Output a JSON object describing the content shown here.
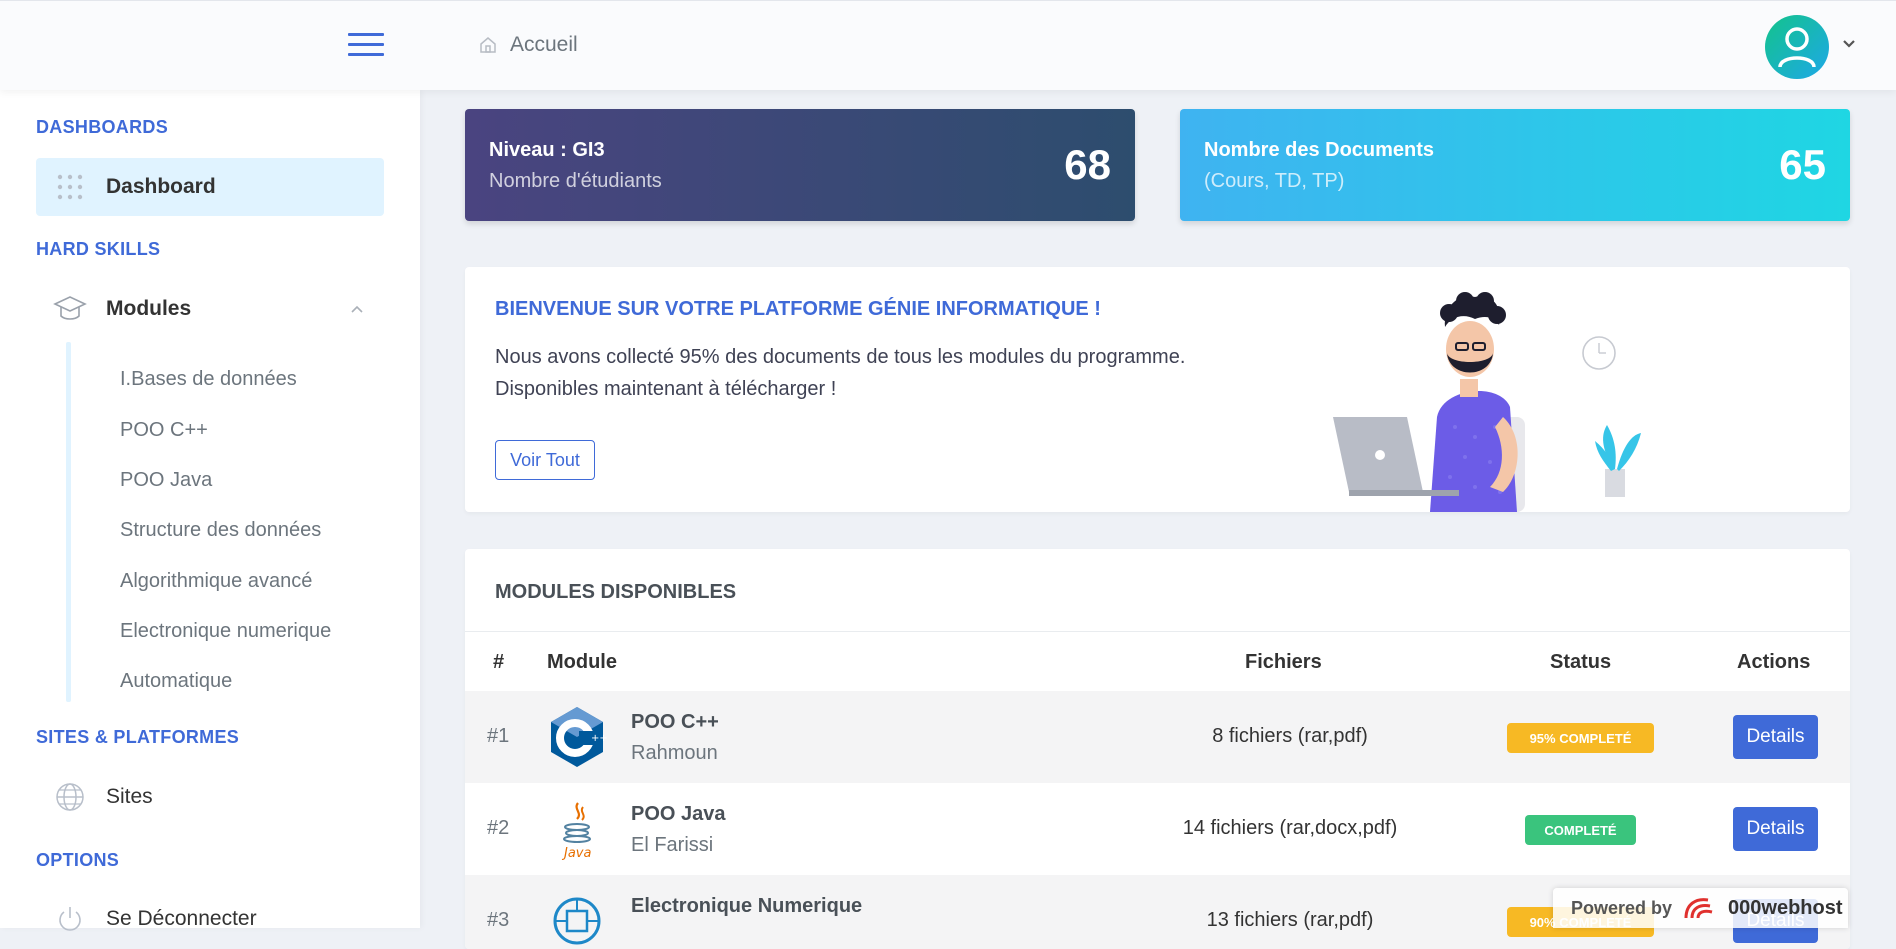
{
  "header": {
    "breadcrumb": "Accueil"
  },
  "sidebar": {
    "sections": {
      "dashboards": "DASHBOARDS",
      "hard_skills": "HARD SKILLS",
      "sites": "SITES & PLATFORMES",
      "options": "OPTIONS"
    },
    "dashboard": "Dashboard",
    "modules": "Modules",
    "submodules": [
      "I.Bases de données",
      "POO C++",
      "POO Java",
      "Structure des données",
      "Algorithmique avancé",
      "Electronique numerique",
      "Automatique"
    ],
    "sites": "Sites",
    "logout": "Se Déconnecter"
  },
  "cards": [
    {
      "title": "Niveau : GI3",
      "subtitle": "Nombre d'étudiants",
      "value": "68"
    },
    {
      "title": "Nombre des Documents",
      "subtitle": "(Cours, TD, TP)",
      "value": "65"
    }
  ],
  "welcome": {
    "title": "BIENVENUE SUR VOTRE PLATFORME GÉNIE INFORMATIQUE !",
    "line1": "Nous avons collecté 95% des documents de tous les modules du programme.",
    "line2": "Disponibles maintenant à télécharger !",
    "button": "Voir Tout"
  },
  "modules": {
    "title": "MODULES DISPONIBLES",
    "headers": [
      "#",
      "Module",
      "Fichiers",
      "Status",
      "Actions"
    ],
    "rows": [
      {
        "num": "#1",
        "name": "POO C++",
        "prof": "Rahmoun",
        "files": "8 fichiers (rar,pdf)",
        "status": "95% COMPLETÉ",
        "action": "Details"
      },
      {
        "num": "#2",
        "name": "POO Java",
        "prof": "El Farissi",
        "files": "14 fichiers (rar,docx,pdf)",
        "status": "COMPLETÉ",
        "action": "Details"
      },
      {
        "num": "#3",
        "name": "Electronique Numerique",
        "prof": "",
        "files": "13 fichiers (rar,pdf)",
        "status": "90% COMPLETÉ",
        "action": "Details"
      }
    ]
  },
  "footer": {
    "powered": "Powered by",
    "brand": "000webhost"
  },
  "colors": {
    "accent": "#3f6ad8",
    "warning": "#f7b924",
    "success": "#3ac47d"
  }
}
